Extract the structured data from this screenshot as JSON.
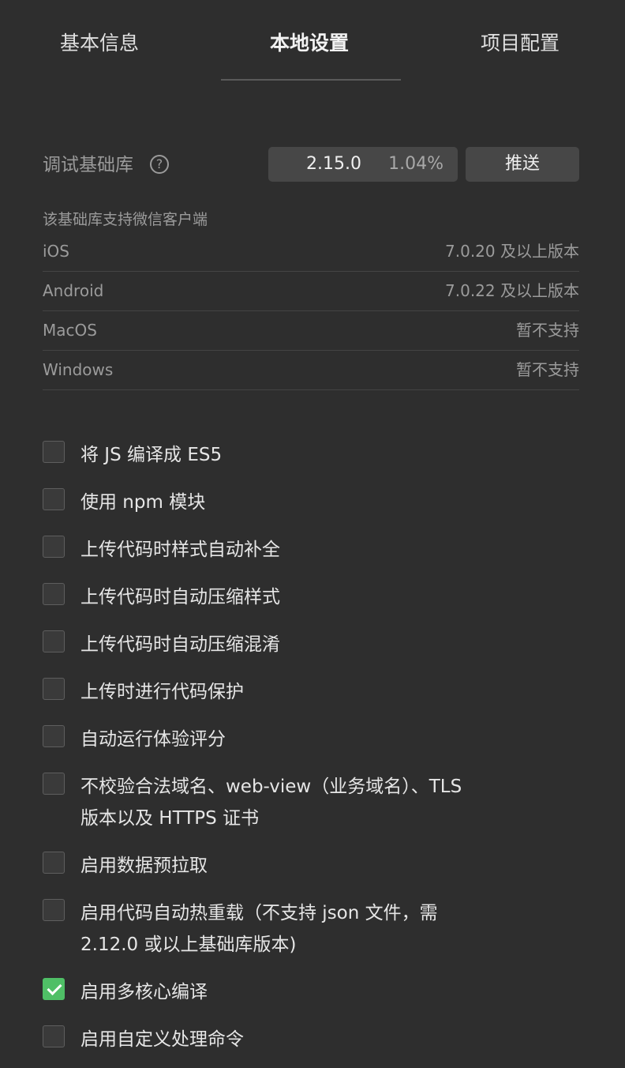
{
  "tabs": [
    {
      "label": "基本信息",
      "active": false
    },
    {
      "label": "本地设置",
      "active": true
    },
    {
      "label": "项目配置",
      "active": false
    }
  ],
  "debug_lib": {
    "label": "调试基础库",
    "help_icon": "question-circle-icon",
    "version": "2.15.0",
    "percent": "1.04%",
    "push_label": "推送"
  },
  "support": {
    "note": "该基础库支持微信客户端",
    "rows": [
      {
        "platform": "iOS",
        "version": "7.0.20 及以上版本"
      },
      {
        "platform": "Android",
        "version": "7.0.22 及以上版本"
      },
      {
        "platform": "MacOS",
        "version": "暂不支持"
      },
      {
        "platform": "Windows",
        "version": "暂不支持"
      }
    ]
  },
  "options": [
    {
      "line1": "将 JS 编译成 ES5",
      "line2": "",
      "checked": false
    },
    {
      "line1": "使用 npm 模块",
      "line2": "",
      "checked": false
    },
    {
      "line1": "上传代码时样式自动补全",
      "line2": "",
      "checked": false
    },
    {
      "line1": "上传代码时自动压缩样式",
      "line2": "",
      "checked": false
    },
    {
      "line1": "上传代码时自动压缩混淆",
      "line2": "",
      "checked": false
    },
    {
      "line1": "上传时进行代码保护",
      "line2": "",
      "checked": false
    },
    {
      "line1": "自动运行体验评分",
      "line2": "",
      "checked": false
    },
    {
      "line1": "不校验合法域名、web-view（业务域名）、TLS",
      "line2": "版本以及 HTTPS 证书",
      "checked": false
    },
    {
      "line1": "启用数据预拉取",
      "line2": "",
      "checked": false
    },
    {
      "line1": "启用代码自动热重载（不支持 json 文件，需",
      "line2": "2.12.0 或以上基础库版本)",
      "checked": false
    },
    {
      "line1": "启用多核心编译",
      "line2": "",
      "checked": true
    },
    {
      "line1": "启用自定义处理命令",
      "line2": "",
      "checked": false
    }
  ],
  "colors": {
    "background": "#2e2e2e",
    "accent_checked": "#4fbf66"
  }
}
